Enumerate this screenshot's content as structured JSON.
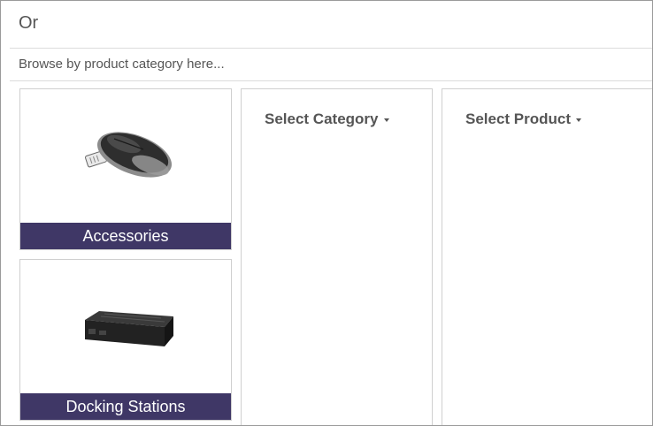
{
  "header": {
    "or_text": "Or",
    "browse_text": "Browse by product category here..."
  },
  "categories": [
    {
      "label": "Accessories",
      "icon": "wireless-mouse-with-usb-receiver"
    },
    {
      "label": "Docking Stations",
      "icon": "docking-station"
    }
  ],
  "selectors": {
    "category_label": "Select Category",
    "product_label": "Select Product"
  },
  "colors": {
    "label_bar": "#3f3766"
  }
}
